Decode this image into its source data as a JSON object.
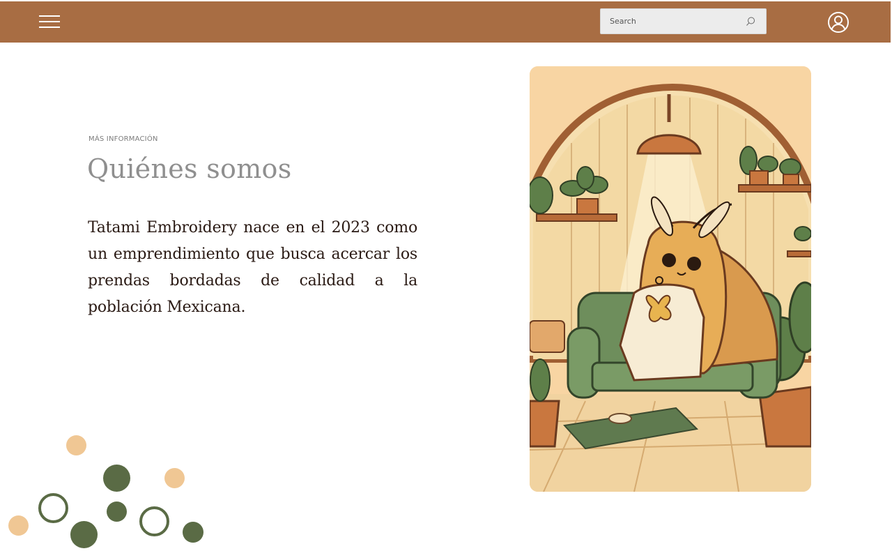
{
  "header": {
    "search_placeholder": "Search",
    "icons": {
      "menu": "hamburger-menu-icon",
      "search": "search-icon",
      "account": "user-account-icon"
    }
  },
  "about": {
    "eyebrow": "MÁS INFORMACIÓN",
    "title": "Quiénes somos",
    "body": "Tatami Embroidery nace en el 2023 como un emprendimiento que busca acercar los prendas bordadas de calidad a la población Mexicana."
  },
  "colors": {
    "header_bg": "#a86d43",
    "accent_peach": "#f0c794",
    "accent_green": "#5a6b45",
    "image_bg": "#f8d5a3"
  }
}
